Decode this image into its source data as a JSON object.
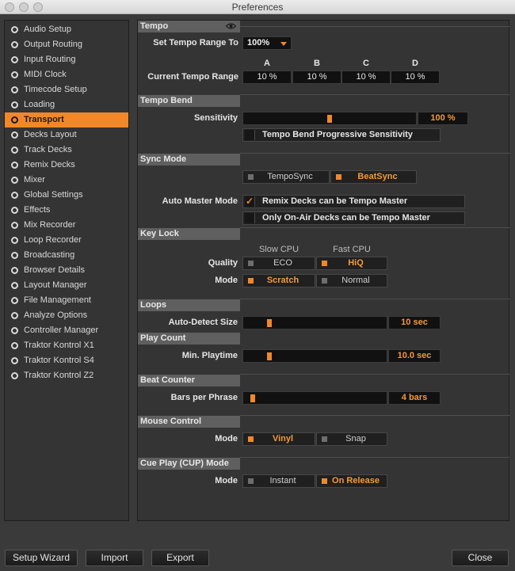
{
  "window": {
    "title": "Preferences"
  },
  "sidebar": {
    "items": [
      {
        "label": "Audio Setup"
      },
      {
        "label": "Output Routing"
      },
      {
        "label": "Input Routing"
      },
      {
        "label": "MIDI Clock"
      },
      {
        "label": "Timecode Setup"
      },
      {
        "label": "Loading"
      },
      {
        "label": "Transport",
        "active": true
      },
      {
        "label": "Decks Layout"
      },
      {
        "label": "Track Decks"
      },
      {
        "label": "Remix Decks"
      },
      {
        "label": "Mixer"
      },
      {
        "label": "Global Settings"
      },
      {
        "label": "Effects"
      },
      {
        "label": "Mix Recorder"
      },
      {
        "label": "Loop Recorder"
      },
      {
        "label": "Broadcasting"
      },
      {
        "label": "Browser Details"
      },
      {
        "label": "Layout Manager"
      },
      {
        "label": "File Management"
      },
      {
        "label": "Analyze Options"
      },
      {
        "label": "Controller Manager"
      },
      {
        "label": "Traktor Kontrol X1"
      },
      {
        "label": "Traktor Kontrol S4"
      },
      {
        "label": "Traktor Kontrol Z2"
      }
    ]
  },
  "tempo": {
    "header": "Tempo",
    "set_range_label": "Set Tempo Range To",
    "set_range_value": "100%",
    "deck_letters": [
      "A",
      "B",
      "C",
      "D"
    ],
    "current_range_label": "Current Tempo Range",
    "current_range_values": [
      "10 %",
      "10 %",
      "10 %",
      "10 %"
    ]
  },
  "tempo_bend": {
    "header": "Tempo Bend",
    "sensitivity_label": "Sensitivity",
    "sensitivity_value": "100 %",
    "sensitivity_level": 0.5,
    "progressive_label": "Tempo Bend Progressive Sensitivity",
    "progressive_checked": false
  },
  "sync_mode": {
    "header": "Sync Mode",
    "tempo_sync": "TempoSync",
    "beat_sync": "BeatSync",
    "selected": "BeatSync",
    "auto_master_label": "Auto Master Mode",
    "remix_master_label": "Remix Decks can be Tempo Master",
    "remix_master_checked": true,
    "onair_label": "Only On-Air Decks can be Tempo Master",
    "onair_checked": false
  },
  "key_lock": {
    "header": "Key Lock",
    "slow_cpu": "Slow CPU",
    "fast_cpu": "Fast CPU",
    "quality_label": "Quality",
    "eco": "ECO",
    "hiq": "HiQ",
    "quality_selected": "HiQ",
    "mode_label": "Mode",
    "scratch": "Scratch",
    "normal": "Normal",
    "mode_selected": "Scratch"
  },
  "loops": {
    "header": "Loops",
    "auto_detect_label": "Auto-Detect Size",
    "auto_detect_value": "10 sec",
    "auto_detect_level": 0.17
  },
  "play_count": {
    "header": "Play Count",
    "min_playtime_label": "Min. Playtime",
    "min_playtime_value": "10.0 sec",
    "min_playtime_level": 0.17
  },
  "beat_counter": {
    "header": "Beat Counter",
    "bars_label": "Bars per Phrase",
    "bars_value": "4 bars",
    "bars_level": 0.05
  },
  "mouse_control": {
    "header": "Mouse Control",
    "mode_label": "Mode",
    "vinyl": "Vinyl",
    "snap": "Snap",
    "selected": "Vinyl"
  },
  "cue_play": {
    "header": "Cue Play (CUP) Mode",
    "mode_label": "Mode",
    "instant": "Instant",
    "on_release": "On Release",
    "selected": "On Release"
  },
  "footer": {
    "setup_wizard": "Setup Wizard",
    "import": "Import",
    "export": "Export",
    "close": "Close"
  },
  "colors": {
    "accent": "#f0882a",
    "panel": "#343434",
    "background": "#3a3a3a"
  }
}
